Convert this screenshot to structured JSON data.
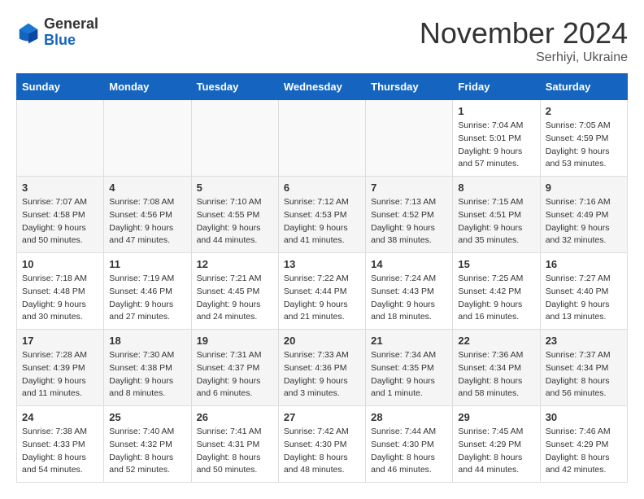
{
  "logo": {
    "general": "General",
    "blue": "Blue"
  },
  "title": "November 2024",
  "location": "Serhiyi, Ukraine",
  "days_of_week": [
    "Sunday",
    "Monday",
    "Tuesday",
    "Wednesday",
    "Thursday",
    "Friday",
    "Saturday"
  ],
  "weeks": [
    [
      {
        "day": "",
        "info": ""
      },
      {
        "day": "",
        "info": ""
      },
      {
        "day": "",
        "info": ""
      },
      {
        "day": "",
        "info": ""
      },
      {
        "day": "",
        "info": ""
      },
      {
        "day": "1",
        "info": "Sunrise: 7:04 AM\nSunset: 5:01 PM\nDaylight: 9 hours and 57 minutes."
      },
      {
        "day": "2",
        "info": "Sunrise: 7:05 AM\nSunset: 4:59 PM\nDaylight: 9 hours and 53 minutes."
      }
    ],
    [
      {
        "day": "3",
        "info": "Sunrise: 7:07 AM\nSunset: 4:58 PM\nDaylight: 9 hours and 50 minutes."
      },
      {
        "day": "4",
        "info": "Sunrise: 7:08 AM\nSunset: 4:56 PM\nDaylight: 9 hours and 47 minutes."
      },
      {
        "day": "5",
        "info": "Sunrise: 7:10 AM\nSunset: 4:55 PM\nDaylight: 9 hours and 44 minutes."
      },
      {
        "day": "6",
        "info": "Sunrise: 7:12 AM\nSunset: 4:53 PM\nDaylight: 9 hours and 41 minutes."
      },
      {
        "day": "7",
        "info": "Sunrise: 7:13 AM\nSunset: 4:52 PM\nDaylight: 9 hours and 38 minutes."
      },
      {
        "day": "8",
        "info": "Sunrise: 7:15 AM\nSunset: 4:51 PM\nDaylight: 9 hours and 35 minutes."
      },
      {
        "day": "9",
        "info": "Sunrise: 7:16 AM\nSunset: 4:49 PM\nDaylight: 9 hours and 32 minutes."
      }
    ],
    [
      {
        "day": "10",
        "info": "Sunrise: 7:18 AM\nSunset: 4:48 PM\nDaylight: 9 hours and 30 minutes."
      },
      {
        "day": "11",
        "info": "Sunrise: 7:19 AM\nSunset: 4:46 PM\nDaylight: 9 hours and 27 minutes."
      },
      {
        "day": "12",
        "info": "Sunrise: 7:21 AM\nSunset: 4:45 PM\nDaylight: 9 hours and 24 minutes."
      },
      {
        "day": "13",
        "info": "Sunrise: 7:22 AM\nSunset: 4:44 PM\nDaylight: 9 hours and 21 minutes."
      },
      {
        "day": "14",
        "info": "Sunrise: 7:24 AM\nSunset: 4:43 PM\nDaylight: 9 hours and 18 minutes."
      },
      {
        "day": "15",
        "info": "Sunrise: 7:25 AM\nSunset: 4:42 PM\nDaylight: 9 hours and 16 minutes."
      },
      {
        "day": "16",
        "info": "Sunrise: 7:27 AM\nSunset: 4:40 PM\nDaylight: 9 hours and 13 minutes."
      }
    ],
    [
      {
        "day": "17",
        "info": "Sunrise: 7:28 AM\nSunset: 4:39 PM\nDaylight: 9 hours and 11 minutes."
      },
      {
        "day": "18",
        "info": "Sunrise: 7:30 AM\nSunset: 4:38 PM\nDaylight: 9 hours and 8 minutes."
      },
      {
        "day": "19",
        "info": "Sunrise: 7:31 AM\nSunset: 4:37 PM\nDaylight: 9 hours and 6 minutes."
      },
      {
        "day": "20",
        "info": "Sunrise: 7:33 AM\nSunset: 4:36 PM\nDaylight: 9 hours and 3 minutes."
      },
      {
        "day": "21",
        "info": "Sunrise: 7:34 AM\nSunset: 4:35 PM\nDaylight: 9 hours and 1 minute."
      },
      {
        "day": "22",
        "info": "Sunrise: 7:36 AM\nSunset: 4:34 PM\nDaylight: 8 hours and 58 minutes."
      },
      {
        "day": "23",
        "info": "Sunrise: 7:37 AM\nSunset: 4:34 PM\nDaylight: 8 hours and 56 minutes."
      }
    ],
    [
      {
        "day": "24",
        "info": "Sunrise: 7:38 AM\nSunset: 4:33 PM\nDaylight: 8 hours and 54 minutes."
      },
      {
        "day": "25",
        "info": "Sunrise: 7:40 AM\nSunset: 4:32 PM\nDaylight: 8 hours and 52 minutes."
      },
      {
        "day": "26",
        "info": "Sunrise: 7:41 AM\nSunset: 4:31 PM\nDaylight: 8 hours and 50 minutes."
      },
      {
        "day": "27",
        "info": "Sunrise: 7:42 AM\nSunset: 4:30 PM\nDaylight: 8 hours and 48 minutes."
      },
      {
        "day": "28",
        "info": "Sunrise: 7:44 AM\nSunset: 4:30 PM\nDaylight: 8 hours and 46 minutes."
      },
      {
        "day": "29",
        "info": "Sunrise: 7:45 AM\nSunset: 4:29 PM\nDaylight: 8 hours and 44 minutes."
      },
      {
        "day": "30",
        "info": "Sunrise: 7:46 AM\nSunset: 4:29 PM\nDaylight: 8 hours and 42 minutes."
      }
    ]
  ]
}
